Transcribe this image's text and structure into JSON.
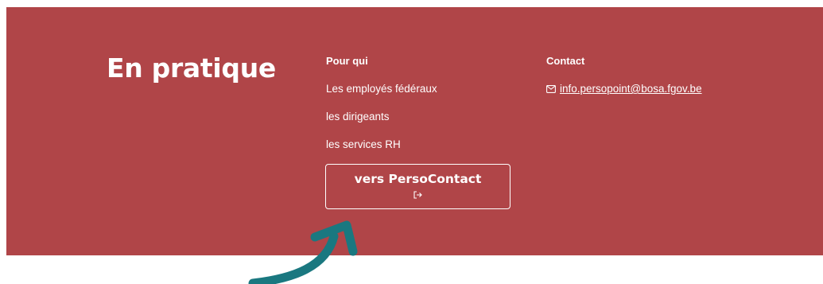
{
  "section": {
    "title": "En pratique",
    "background_color": "#b04548"
  },
  "audience": {
    "heading": "Pour qui",
    "items": [
      "Les employés fédéraux",
      "les dirigeants",
      "les services RH"
    ]
  },
  "contact": {
    "heading": "Contact",
    "icon": "mail-icon",
    "email": "info.persopoint@bosa.fgov.be"
  },
  "cta": {
    "label": "vers PersoContact",
    "icon": "external-link-icon"
  },
  "annotation": {
    "icon": "curved-arrow-icon",
    "color": "#1a7880"
  }
}
